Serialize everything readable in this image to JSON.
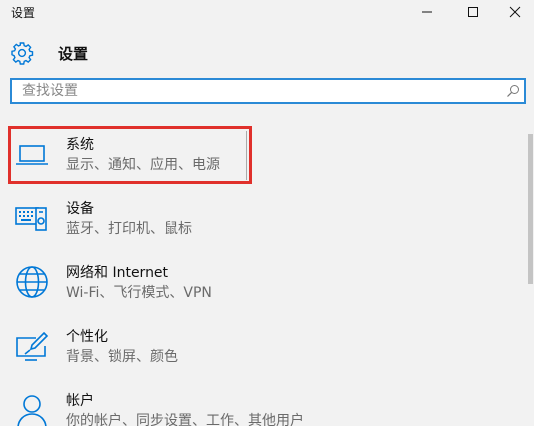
{
  "window": {
    "title": "设置"
  },
  "header": {
    "title": "设置",
    "icon": "gear-icon"
  },
  "search": {
    "placeholder": "查找设置",
    "value": "",
    "icon": "search-icon"
  },
  "categories": [
    {
      "name": "系统",
      "desc": "显示、通知、应用、电源",
      "icon": "laptop-icon",
      "selected": true
    },
    {
      "name": "设备",
      "desc": "蓝牙、打印机、鼠标",
      "icon": "devices-icon",
      "selected": false
    },
    {
      "name": "网络和 Internet",
      "desc": "Wi-Fi、飞行模式、VPN",
      "icon": "globe-icon",
      "selected": false
    },
    {
      "name": "个性化",
      "desc": "背景、锁屏、颜色",
      "icon": "personalize-icon",
      "selected": false
    },
    {
      "name": "帐户",
      "desc": "你的帐户、同步设置、工作、其他用户",
      "icon": "account-icon",
      "selected": false
    }
  ],
  "colors": {
    "accent": "#0078d7",
    "highlight_border": "#e0302b",
    "search_border": "#2b8ad6",
    "background": "#f2f2f2"
  }
}
